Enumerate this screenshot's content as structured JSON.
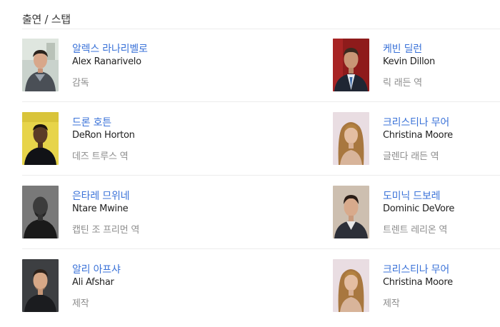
{
  "section": {
    "title": "출연 / 스탭"
  },
  "rows": [
    {
      "left": {
        "name_ko": "알렉스 라나리벨로",
        "name_en": "Alex Ranarivelo",
        "role": "감독",
        "photo": "portrait-alex-ranarivelo"
      },
      "right": {
        "name_ko": "케빈 딜런",
        "name_en": "Kevin Dillon",
        "role": "릭 래든 역",
        "photo": "portrait-kevin-dillon"
      }
    },
    {
      "left": {
        "name_ko": "드론 호튼",
        "name_en": "DeRon Horton",
        "role": "데즈 트루스 역",
        "photo": "portrait-deron-horton"
      },
      "right": {
        "name_ko": "크리스티나 무어",
        "name_en": "Christina Moore",
        "role": "글렌다 래든 역",
        "photo": "portrait-christina-moore"
      }
    },
    {
      "left": {
        "name_ko": "은타레 므위네",
        "name_en": "Ntare Mwine",
        "role": "캡틴 조 프리먼 역",
        "photo": "portrait-ntare-mwine"
      },
      "right": {
        "name_ko": "도미닉 드보레",
        "name_en": "Dominic DeVore",
        "role": "트렌트 레리온 역",
        "photo": "portrait-dominic-devore"
      }
    },
    {
      "left": {
        "name_ko": "알리 아프샤",
        "name_en": "Ali Afshar",
        "role": "제작",
        "photo": "portrait-ali-afshar"
      },
      "right": {
        "name_ko": "크리스티나 무어",
        "name_en": "Christina Moore",
        "role": "제작",
        "photo": "portrait-christina-moore"
      }
    }
  ]
}
